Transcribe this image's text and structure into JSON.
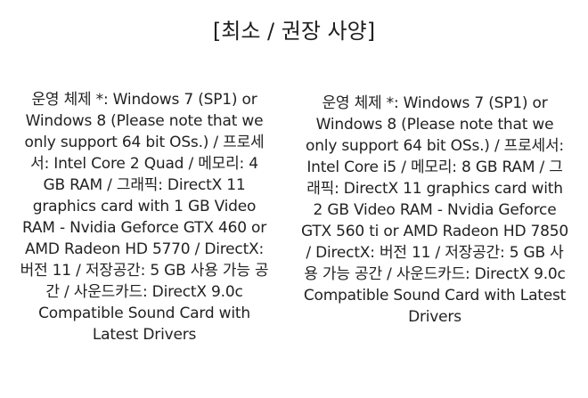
{
  "header": {
    "title": "[최소 / 권장 사양]"
  },
  "specs": {
    "minimum": "운영 체제 *: Windows 7 (SP1) or Windows 8 (Please note that we only support 64 bit OSs.) / 프로세서: Intel Core 2 Quad / 메모리: 4 GB RAM / 그래픽: DirectX 11 graphics card with 1 GB Video RAM - Nvidia Geforce GTX 460 or AMD Radeon HD 5770 / DirectX: 버전 11 / 저장공간: 5 GB 사용 가능 공간 / 사운드카드: DirectX 9.0c Compatible Sound Card with Latest Drivers",
    "recommended": "운영 체제 *: Windows 7 (SP1) or Windows 8 (Please note that we only support 64 bit OSs.) / 프로세서: Intel Core i5 / 메모리: 8 GB RAM / 그래픽: DirectX 11 graphics card with 2 GB Video RAM - Nvidia Geforce GTX 560 ti or AMD Radeon HD 7850 / DirectX: 버전 11 / 저장공간: 5 GB 사용 가능 공간 / 사운드카드: DirectX 9.0c Compatible Sound Card with Latest Drivers"
  }
}
